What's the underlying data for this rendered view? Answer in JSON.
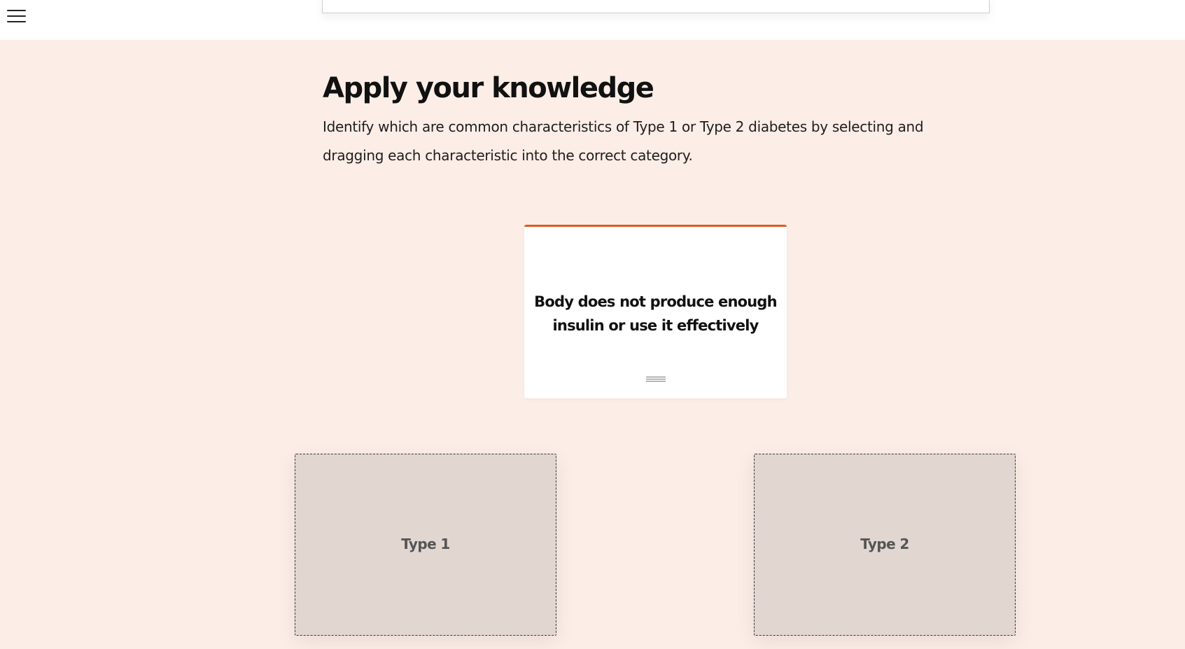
{
  "header": {
    "menu_icon": "hamburger-menu-icon"
  },
  "activity": {
    "title": "Apply your knowledge",
    "instructions": "Identify which are common characteristics of Type 1 or Type 2 diabetes by selecting and dragging each characteristic into the correct category.",
    "card": {
      "text": "Body does not produce enough insulin or use it effectively",
      "handle_icon": "drag-handle-icon",
      "accent_color": "#e05a1e"
    },
    "categories": [
      {
        "label": "Type 1"
      },
      {
        "label": "Type 2"
      }
    ]
  },
  "colors": {
    "section_background": "#fcede7",
    "dropzone_background": "#e2d6d1",
    "accent": "#e05a1e"
  }
}
